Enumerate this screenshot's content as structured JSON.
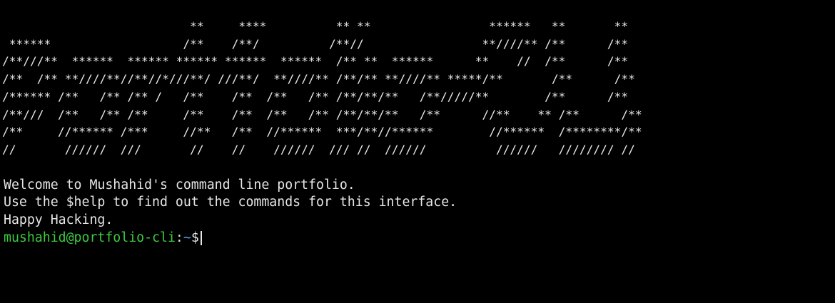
{
  "terminal": {
    "banner_lines": [
      "                           **     ****          ** **                 ******   **       **",
      " ******                   /**    /**/          /**//                 **////** /**      /**",
      "/**///**  ******  ****** ****** ******  ******  /** **  ******      **    //  /**      /**",
      "/**  /** **////**//**//*///**/ ///**/  **////** /**/** **////** *****/**       /**      /**",
      "/****** /**   /** /** /   /**    /**  /**   /** /**/**/**   /**/////**        /**      /**",
      "/**///  /**   /** /**     /**    /**  /**   /** /**/**/**   /**      //**    ** /**      /**",
      "/**     //****** /***     //**   /**  //******  ***/**//******        //******  /********/**",
      "//       //////  ///       //    //    //////  /// //  //////          //////   //////// //"
    ],
    "output_lines": [
      "Welcome to Mushahid's command line portfolio.",
      "Use the $help to find out the commands for this interface.",
      "Happy Hacking."
    ],
    "prompt": {
      "user_host": "mushahid@portfolio-cli",
      "separator": ":",
      "path": "~",
      "symbol": "$",
      "input": ""
    },
    "colors": {
      "background": "#000000",
      "text": "#e6e6e6",
      "user_host": "#3ec93e",
      "path": "#4fa3f7"
    }
  }
}
